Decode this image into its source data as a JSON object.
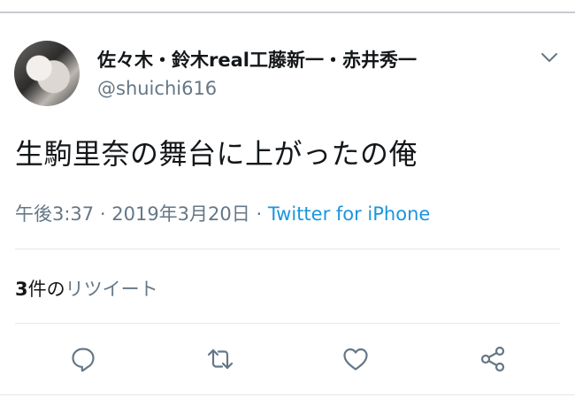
{
  "tweet": {
    "display_name": "佐々木・鈴木real工藤新一・赤井秀一",
    "handle": "@shuichi616",
    "text": "生駒里奈の舞台に上がったの俺",
    "time": "午後3:37",
    "separator": "·",
    "date": "2019年3月20日",
    "source": "Twitter for iPhone",
    "retweet_count": "3",
    "retweet_unit": "件の",
    "retweet_label": "リツイート"
  },
  "actions": {
    "reply_icon": "reply-icon",
    "retweet_icon": "retweet-icon",
    "like_icon": "like-icon",
    "share_icon": "share-icon"
  },
  "colors": {
    "text": "#14171a",
    "secondary": "#657786",
    "link": "#1b95e0",
    "divider": "#e1e8ed"
  }
}
